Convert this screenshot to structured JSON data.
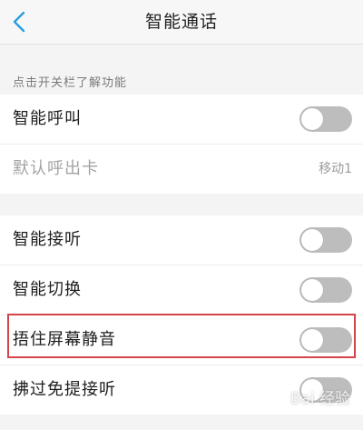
{
  "header": {
    "title": "智能通话",
    "back_icon": "chevron-left-icon"
  },
  "section_label": "点击开关栏了解功能",
  "group1": {
    "items": [
      {
        "label": "智能呼叫",
        "type": "toggle",
        "on": false
      },
      {
        "label": "默认呼出卡",
        "type": "value",
        "value": "移动1",
        "disabled": true
      }
    ]
  },
  "group2": {
    "items": [
      {
        "label": "智能接听",
        "type": "toggle",
        "on": false
      },
      {
        "label": "智能切换",
        "type": "toggle",
        "on": false
      },
      {
        "label": "捂住屏幕静音",
        "type": "toggle",
        "on": false
      },
      {
        "label": "拂过免提接听",
        "type": "toggle",
        "on": false
      }
    ]
  },
  "watermark": "Bai 经验",
  "colors": {
    "accent": "#2a9ee0",
    "toggle_off": "#bdbdbd",
    "highlight": "#d3444b",
    "background": "#f4f4f4"
  }
}
